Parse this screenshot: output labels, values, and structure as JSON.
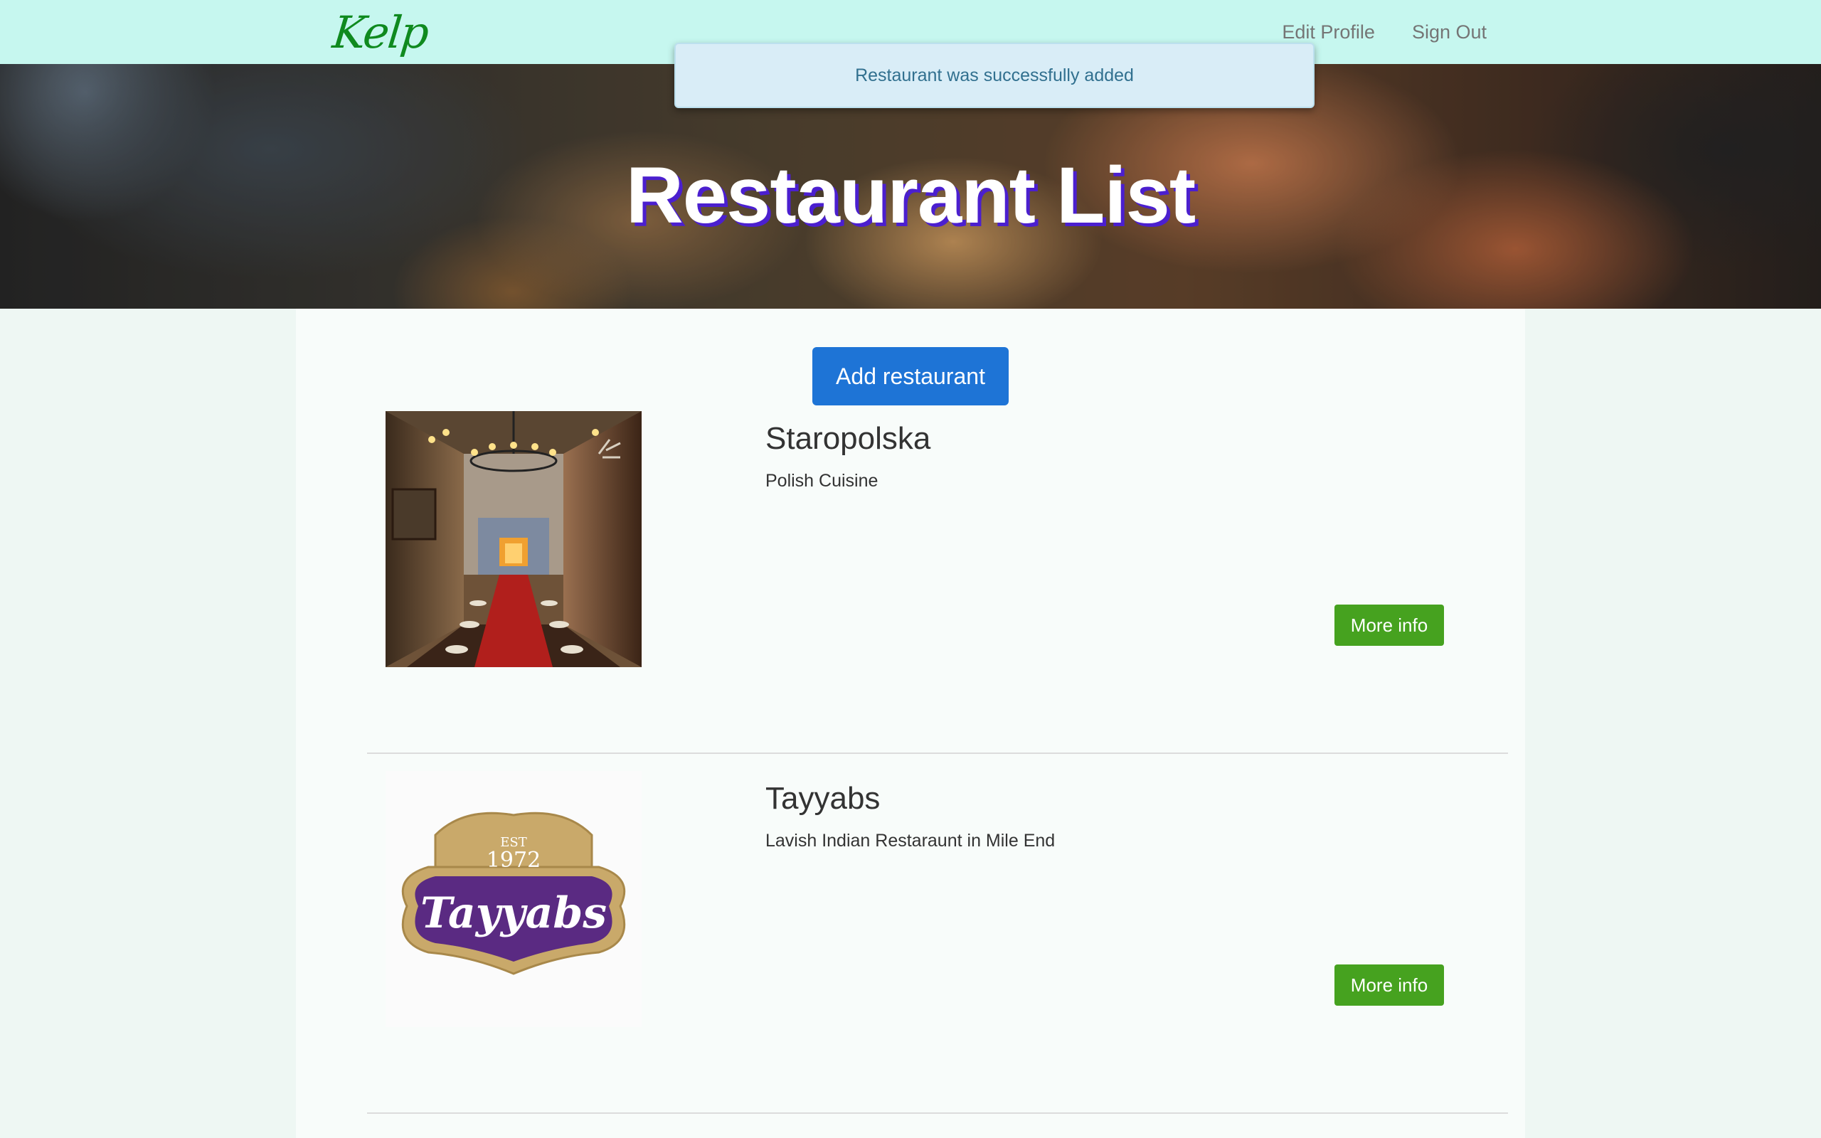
{
  "nav": {
    "brand": "Kelp",
    "links": [
      "Edit Profile",
      "Sign Out"
    ]
  },
  "flash": {
    "message": "Restaurant was successfully added"
  },
  "hero": {
    "title": "Restaurant List"
  },
  "main": {
    "add_button": "Add restaurant",
    "restaurants": [
      {
        "name": "Staropolska",
        "description": "Polish Cuisine",
        "button": "More info"
      },
      {
        "name": "Tayyabs",
        "description": "Lavish Indian Restaraunt in Mile End",
        "button": "More info",
        "logo": {
          "est": "EST",
          "year": "1972",
          "wordmark": "Tayyabs"
        }
      }
    ]
  },
  "colors": {
    "navbar_bg": "#c6f7ef",
    "brand": "#0f8a1f",
    "flash_bg": "#d9edf7",
    "flash_text": "#31708f",
    "hero_shadow": "#4b1fcf",
    "primary_button": "#1e74d6",
    "success_button": "#46a21f"
  }
}
